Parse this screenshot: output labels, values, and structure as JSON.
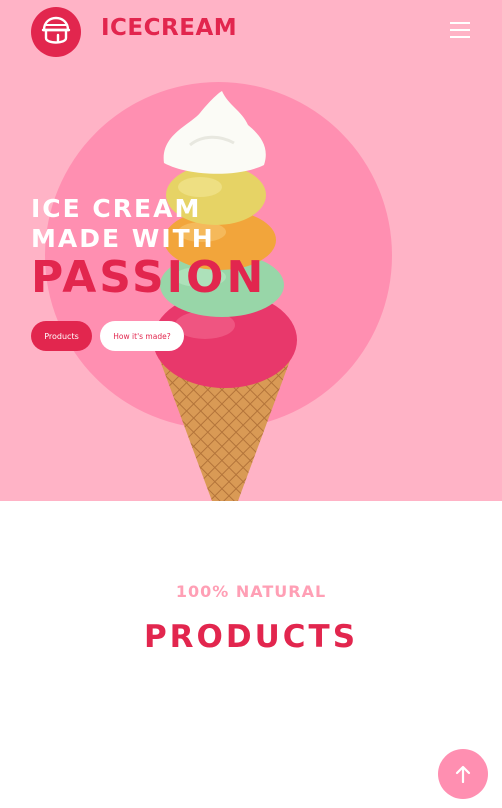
{
  "header": {
    "brand_name": "ICECREAM",
    "logo_icon": "ice-cream-scoop-icon",
    "menu_icon": "hamburger-menu-icon"
  },
  "hero": {
    "headline_line_1": "ICE CREAM",
    "headline_line_2": "MADE WITH",
    "headline_accent": "PASSION",
    "primary_button_label": "Products",
    "secondary_button_label": "How it's made?",
    "image": "ice-cream-cone-with-five-scoops"
  },
  "products_section": {
    "eyebrow": "100% NATURAL",
    "title": "PRODUCTS"
  },
  "back_to_top_icon": "arrow-up-icon",
  "colors": {
    "brand": "#e2264e",
    "hero_background": "#ffb3c6",
    "hero_circle": "#ff8fb1",
    "eyebrow": "#ff9fb5",
    "page_background": "#ffffff"
  }
}
